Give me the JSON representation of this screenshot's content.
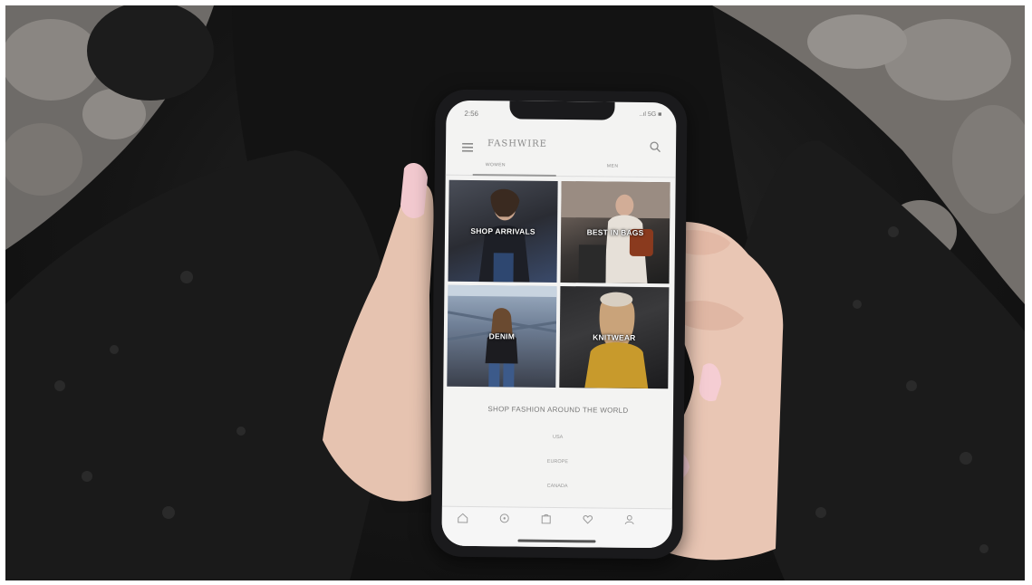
{
  "photo": {
    "description_tags": [
      "hands-holding-phone",
      "black-fleece-sleeves",
      "dark-leggings",
      "stone-floor"
    ]
  },
  "status_bar": {
    "time": "2:56",
    "indicators": "..ıl 5G ■"
  },
  "app": {
    "logo_text": "FASHWIRE",
    "menu_icon": "hamburger-menu-icon",
    "search_icon": "search-icon"
  },
  "tabs": [
    {
      "label": "WOMEN",
      "selected": true
    },
    {
      "label": "MEN",
      "selected": false
    }
  ],
  "tiles": [
    {
      "label": "SHOP ARRIVALS"
    },
    {
      "label": "BEST IN BAGS"
    },
    {
      "label": "DENIM"
    },
    {
      "label": "KNITWEAR"
    }
  ],
  "section": {
    "title": "SHOP FASHION AROUND THE WORLD",
    "countries": [
      "USA",
      "EUROPE",
      "CANADA"
    ]
  },
  "bottom_nav": [
    {
      "label": "",
      "icon": "home-icon"
    },
    {
      "label": "",
      "icon": "discover-icon"
    },
    {
      "label": "",
      "icon": "shop-icon"
    },
    {
      "label": "",
      "icon": "wishlist-icon"
    },
    {
      "label": "",
      "icon": "profile-icon"
    }
  ],
  "colors": {
    "screen_bg": "#f3f3f2",
    "phone_frame": "#1a1a1c",
    "text_muted": "#7a7a7a"
  }
}
